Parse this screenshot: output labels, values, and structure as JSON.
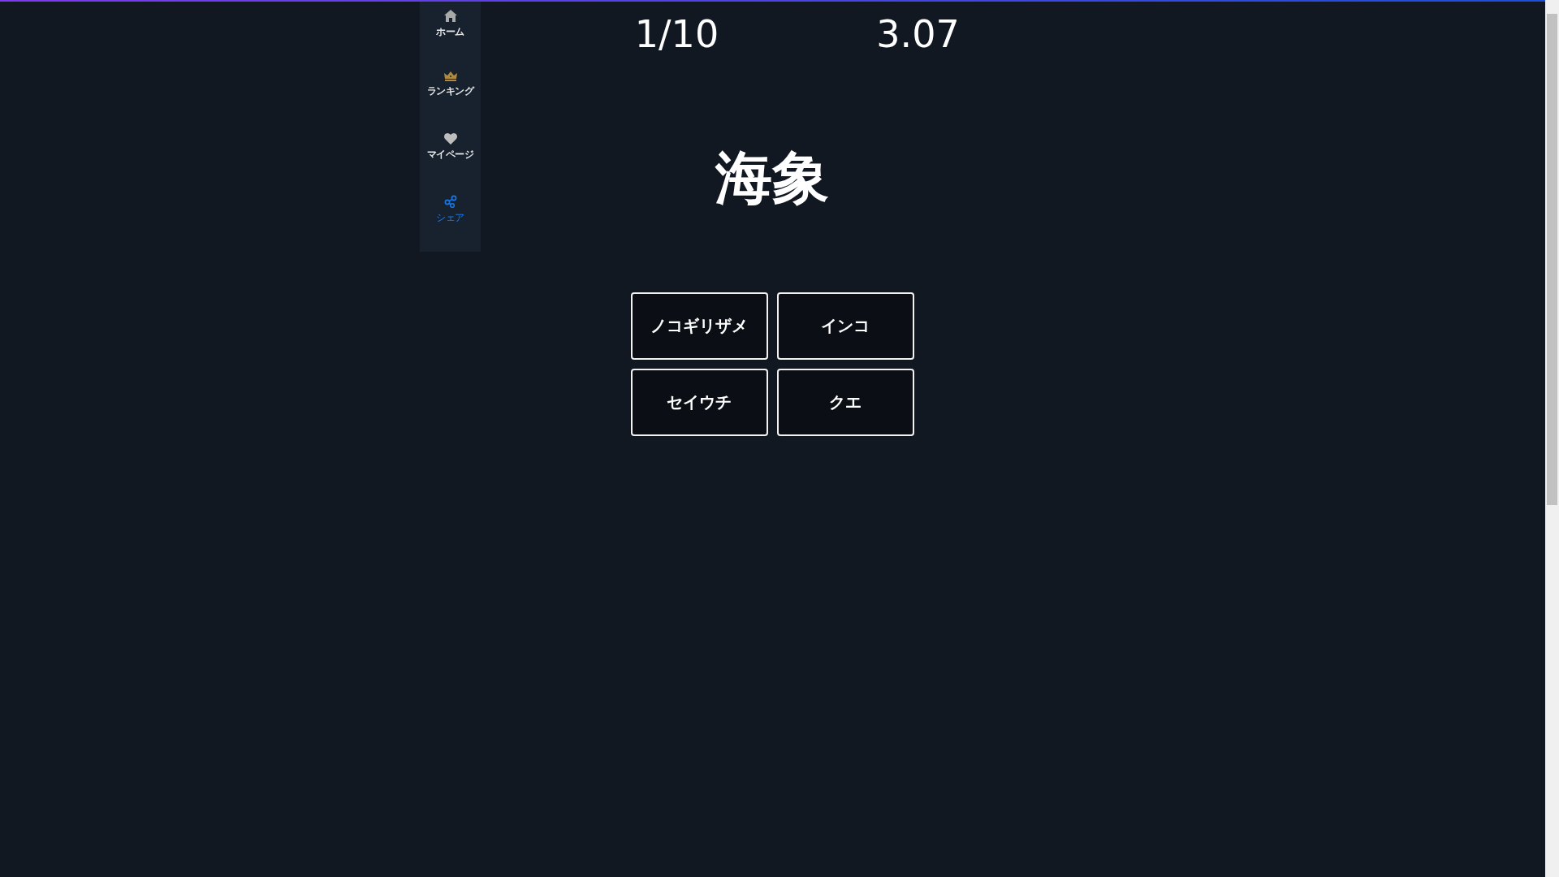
{
  "sidebar": {
    "items": [
      {
        "label": "ホーム",
        "selected": false
      },
      {
        "label": "ランキング",
        "selected": false
      },
      {
        "label": "マイページ",
        "selected": false
      },
      {
        "label": "シェア",
        "selected": true
      }
    ]
  },
  "quiz": {
    "progress": "1/10",
    "timer": "3.07",
    "question": "海象",
    "choices": [
      "ノコギリザメ",
      "インコ",
      "セイウチ",
      "クエ"
    ]
  }
}
